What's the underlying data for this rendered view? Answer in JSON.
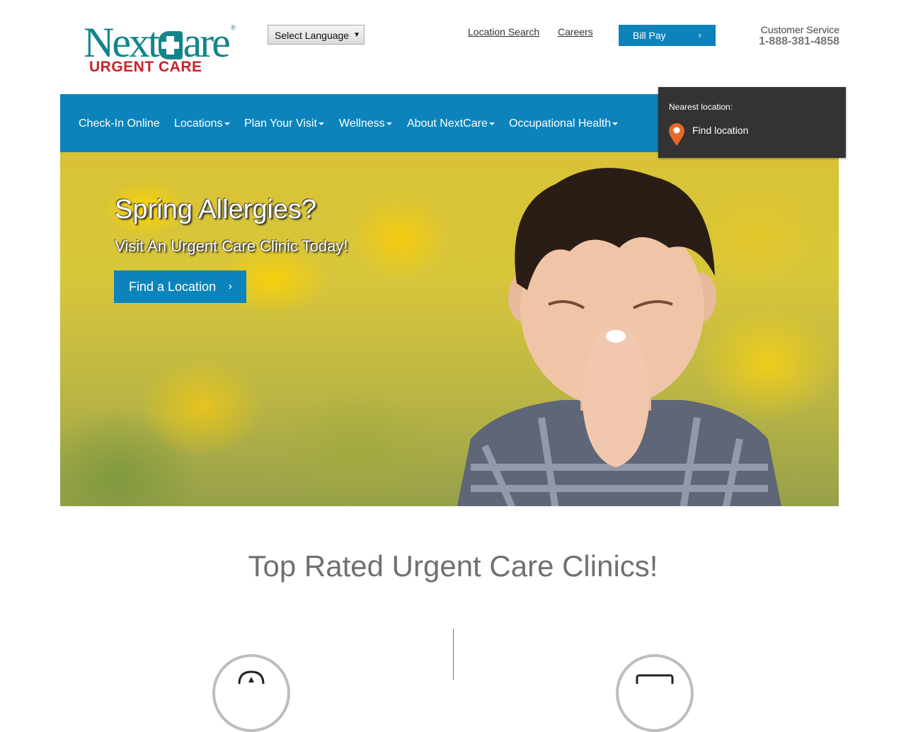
{
  "header": {
    "logo": {
      "brand_part1": "Next",
      "brand_part2": "are",
      "registered": "®",
      "tagline": "URGENT CARE"
    },
    "language_select": {
      "selected": "Select Language",
      "arrow": "▼"
    },
    "links": {
      "location_search": "Location Search",
      "careers": "Careers"
    },
    "bill_pay": {
      "label": "Bill Pay",
      "chevron": "›"
    },
    "customer_service": {
      "label": "Customer Service",
      "phone": "1-888-381-4858"
    }
  },
  "nav": {
    "items": [
      {
        "label": "Check-In Online",
        "dropdown": false
      },
      {
        "label": "Locations",
        "dropdown": true
      },
      {
        "label": "Plan Your Visit",
        "dropdown": true
      },
      {
        "label": "Wellness",
        "dropdown": true
      },
      {
        "label": "About NextCare",
        "dropdown": true
      },
      {
        "label": "Occupational Health",
        "dropdown": true
      }
    ]
  },
  "nearest_location": {
    "label": "Nearest location:",
    "action": "Find location"
  },
  "hero": {
    "title": "Spring Allergies?",
    "subtitle": "Visit An Urgent Care Clinic Today!",
    "button": {
      "label": "Find a Location",
      "chevron": "›"
    },
    "image_alt": "Boy sneezing in a field of yellow flowers"
  },
  "main": {
    "headline": "Top Rated Urgent Care Clinics!"
  },
  "colors": {
    "brand_teal": "#12858a",
    "brand_red": "#c8232c",
    "primary_blue": "#0c84bb",
    "panel_dark": "#333333",
    "pin_orange": "#e8682a",
    "headline_gray": "#707070"
  }
}
